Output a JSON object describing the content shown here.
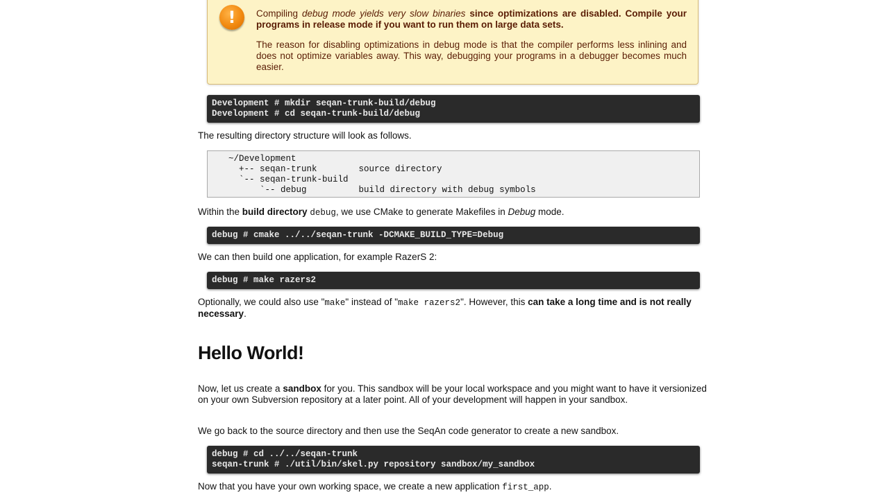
{
  "warning": {
    "icon": "exclamation-icon",
    "icon_glyph": "!",
    "p1_part1": "Compiling ",
    "p1_em": "debug mode yields very slow binaries",
    "p1_strong": " since optimizations are disabled. Compile your programs in release mode if you want to run them on large data sets.",
    "p2": "The reason for disabling optimizations in debug mode is that the compiler performs less inlining and does not optimize variables away. This way, debugging your programs in a debugger becomes much easier."
  },
  "code1": "Development # mkdir seqan-trunk-build/debug\nDevelopment # cd seqan-trunk-build/debug",
  "p_structure": "The resulting directory structure will look as follows.",
  "tree": "~/Development\n  +-- seqan-trunk        source directory\n  `-- seqan-trunk-build\n      `-- debug          build directory with debug symbols",
  "p_within": {
    "a": "Within the ",
    "strong": "build directory",
    "code": "debug",
    "b": ", we use CMake to generate Makefiles in ",
    "em": "Debug",
    "c": " mode."
  },
  "code2": "debug # cmake ../../seqan-trunk -DCMAKE_BUILD_TYPE=Debug",
  "p_build": "We can then build one application, for example RazerS 2:",
  "code3": "debug # make razers2",
  "p_optional": {
    "a": "Optionally, we could also use \"",
    "code1": "make",
    "b": "\" instead of \"",
    "code2": "make razers2",
    "c": "\". However, this ",
    "strong": "can take a long time and is not really necessary",
    "d": "."
  },
  "heading": "Hello World!",
  "p_sandbox": {
    "a": "Now, let us create a ",
    "strong": "sandbox",
    "b": " for you. This sandbox will be your local workspace and you might want to have it versionized on your own Subversion repository at a later point. All of your development will happen in your sandbox."
  },
  "p_goback": "We go back to the source directory and then use the SeqAn code generator to create a new sandbox.",
  "code4": "debug # cd ../../seqan-trunk\nseqan-trunk # ./util/bin/skel.py repository sandbox/my_sandbox",
  "p_now": {
    "a": "Now that you have your own working space, we create a new application ",
    "code": "first_app",
    "b": "."
  }
}
